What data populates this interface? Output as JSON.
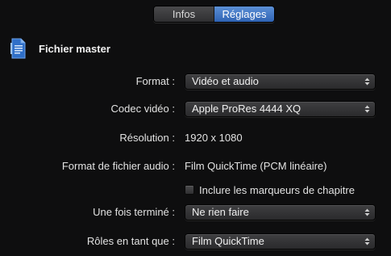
{
  "tabs": [
    {
      "label": "Infos",
      "active": false
    },
    {
      "label": "Réglages",
      "active": true
    }
  ],
  "header": {
    "icon": "file-document-icon",
    "title": "Fichier master"
  },
  "settings": {
    "format": {
      "label": "Format :",
      "value": "Vidéo et audio"
    },
    "codec": {
      "label": "Codec vidéo :",
      "value": "Apple ProRes 4444 XQ"
    },
    "resolution": {
      "label": "Résolution :",
      "value": "1920 x 1080"
    },
    "audio_format": {
      "label": "Format de fichier audio :",
      "value": "Film QuickTime (PCM linéaire)"
    },
    "chapter_markers": {
      "label": "Inclure les marqueurs de chapitre",
      "checked": false
    },
    "when_done": {
      "label": "Une fois terminé :",
      "value": "Ne rien faire"
    },
    "roles": {
      "label": "Rôles en tant que :",
      "value": "Film QuickTime"
    }
  },
  "colors": {
    "background": "#0e0e0f",
    "accent": "#3f73c4",
    "popup": "#343436"
  }
}
